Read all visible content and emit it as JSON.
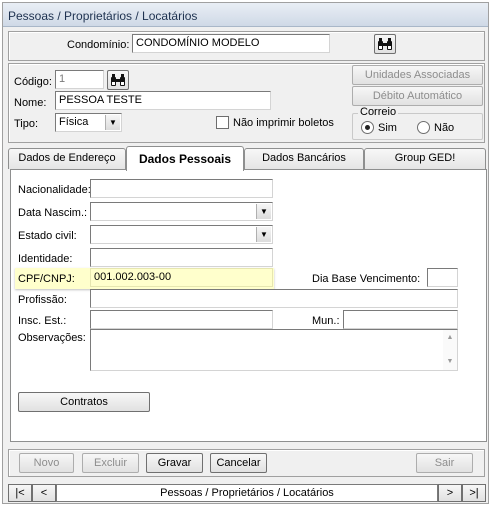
{
  "window": {
    "title": "Pessoas / Proprietários / Locatários"
  },
  "condominio": {
    "label": "Condomínio:",
    "value": "CONDOMÍNIO MODELO",
    "search_icon": "binoculars-icon"
  },
  "person": {
    "codigo_label": "Código:",
    "codigo_value": "1",
    "nome_label": "Nome:",
    "nome_value": "PESSOA TESTE",
    "tipo_label": "Tipo:",
    "tipo_value": "Física",
    "nao_imprimir_label": "Não imprimir boletos",
    "nao_imprimir_checked": false,
    "search_icon": "binoculars-icon"
  },
  "side_buttons": {
    "unidades": "Unidades Associadas",
    "debito": "Débito Automático"
  },
  "correio": {
    "label": "Correio",
    "options": [
      "Sim",
      "Não"
    ],
    "selected": "Sim"
  },
  "tabs": [
    {
      "label": "Dados de Endereço",
      "active": false
    },
    {
      "label": "Dados Pessoais",
      "active": true
    },
    {
      "label": "Dados Bancários",
      "active": false
    },
    {
      "label": "Group GED!",
      "active": false
    }
  ],
  "dados_pessoais": {
    "nacionalidade_label": "Nacionalidade:",
    "nacionalidade_value": "",
    "data_nasc_label": "Data Nascim.:",
    "data_nasc_value": "",
    "estado_civil_label": "Estado civil:",
    "estado_civil_value": "",
    "identidade_label": "Identidade:",
    "identidade_value": "",
    "cpf_label": "CPF/CNPJ:",
    "cpf_value": "001.002.003-00",
    "dia_base_label": "Dia Base Vencimento:",
    "dia_base_value": "",
    "profissao_label": "Profissão:",
    "profissao_value": "",
    "insc_label": "Insc. Est.:",
    "insc_value": "",
    "mun_label": "Mun.:",
    "mun_value": "",
    "obs_label": "Observações:",
    "obs_value": "",
    "contratos_label": "Contratos"
  },
  "actions": {
    "novo": "Novo",
    "excluir": "Excluir",
    "gravar": "Gravar",
    "cancelar": "Cancelar",
    "sair": "Sair"
  },
  "navigator": {
    "first": "|<",
    "prev": "<",
    "caption": "Pessoas / Proprietários / Locatários",
    "next": ">",
    "last": ">|"
  },
  "colors": {
    "highlight": "#ffffcc",
    "window_bg": "#f0f0f0",
    "title_text": "#1e3250"
  }
}
